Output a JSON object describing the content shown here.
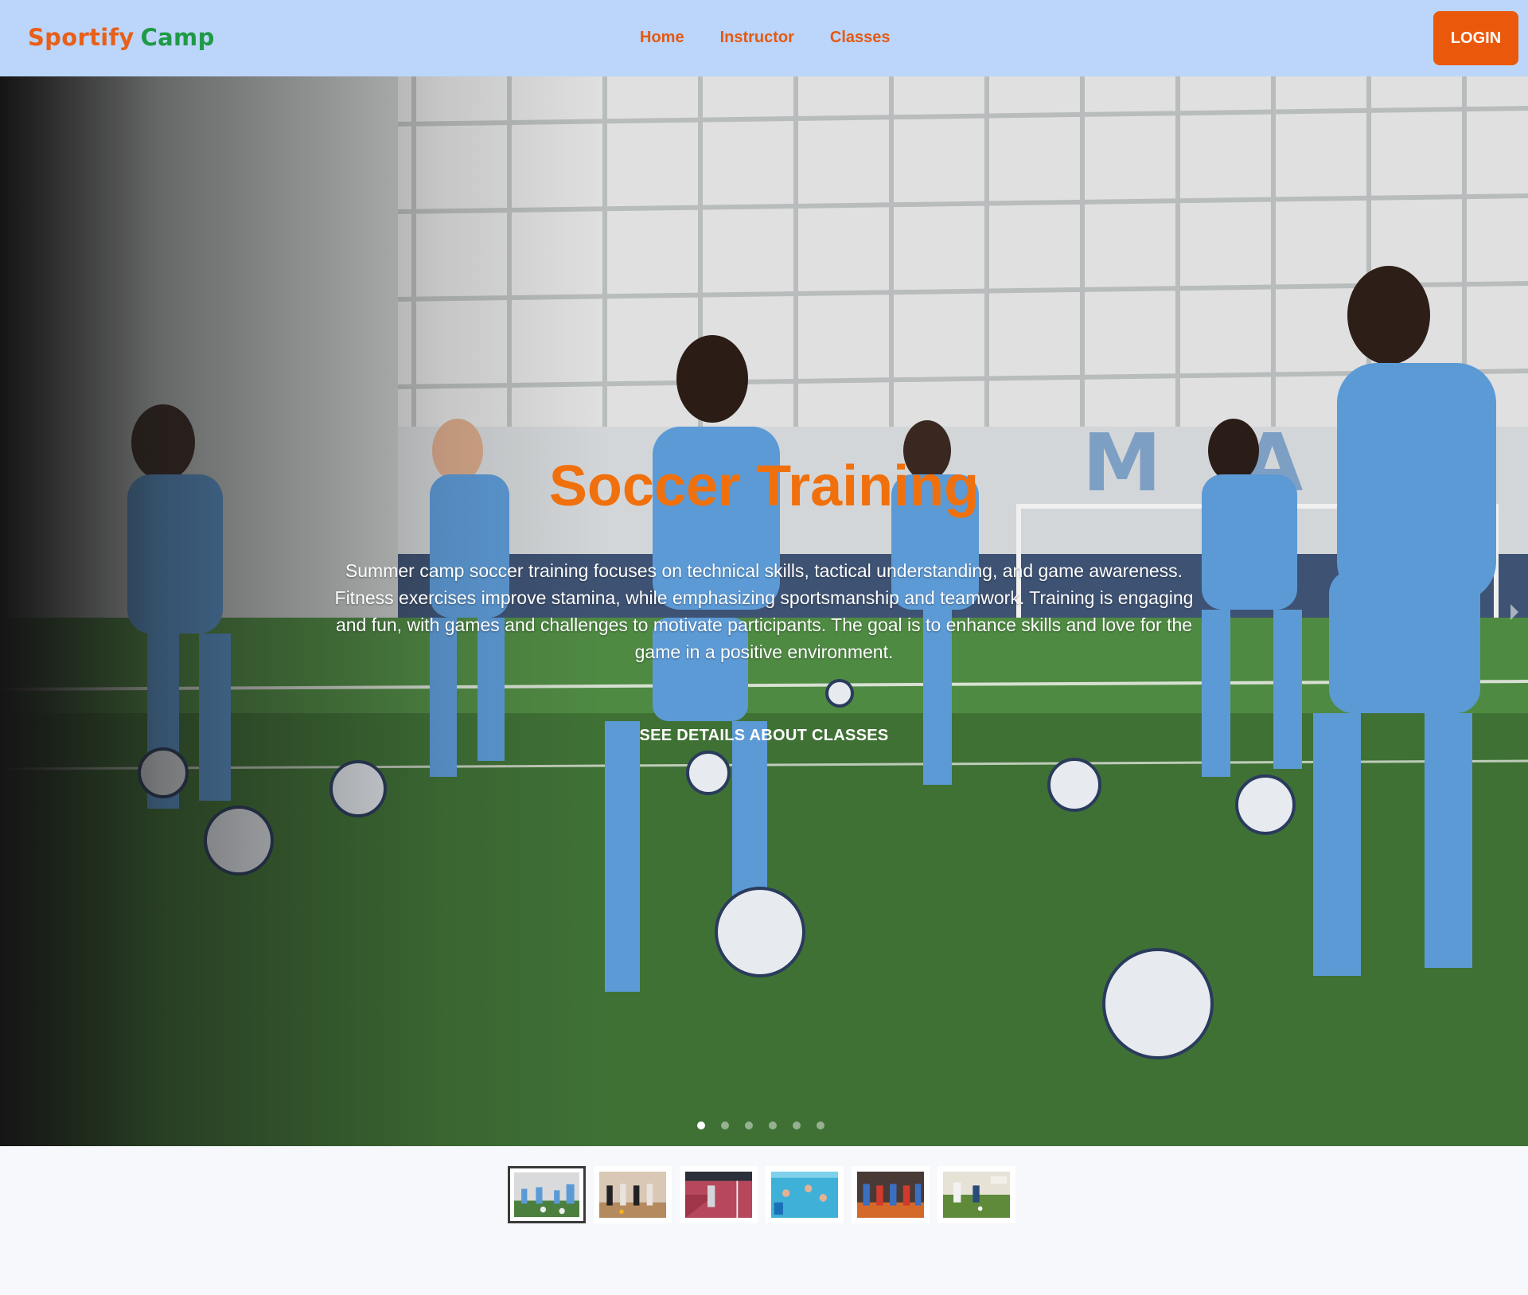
{
  "brand": {
    "part1": "Sportify",
    "part2": "Camp"
  },
  "nav": {
    "links": [
      "Home",
      "Instructor",
      "Classes"
    ],
    "login_label": "LOGIN"
  },
  "hero": {
    "title": "Soccer Training",
    "description": "Summer camp soccer training focuses on technical skills, tactical understanding, and game awareness. Fitness exercises improve stamina, while emphasizing sportsmanship and teamwork. Training is engaging and fun, with games and challenges to motivate participants. The goal is to enhance skills and love for the game in a positive environment.",
    "cta_label": "SEE DETAILS ABOUT CLASSES",
    "slide_count": 6,
    "active_slide": 0
  },
  "colors": {
    "navbar_bg": "#bcd5fa",
    "accent_orange": "#ea580c",
    "brand_green": "#1e9a47",
    "title_orange": "#f0700d"
  },
  "thumbnails": [
    {
      "name": "soccer-thumbnail",
      "active": true
    },
    {
      "name": "dance-thumbnail",
      "active": false
    },
    {
      "name": "tennis-thumbnail",
      "active": false
    },
    {
      "name": "swimming-thumbnail",
      "active": false
    },
    {
      "name": "basketball-thumbnail",
      "active": false
    },
    {
      "name": "golf-thumbnail",
      "active": false
    }
  ]
}
